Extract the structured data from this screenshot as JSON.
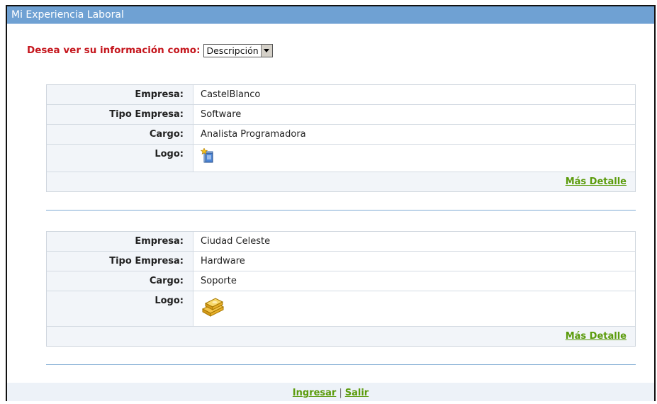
{
  "window": {
    "title": "Mi Experiencia Laboral"
  },
  "view_selector": {
    "label": "Desea ver su información como:",
    "selected": "Descripción"
  },
  "labels": {
    "empresa": "Empresa:",
    "tipo": "Tipo Empresa:",
    "cargo": "Cargo:",
    "logo": "Logo:"
  },
  "experiences": [
    {
      "empresa": "CastelBlanco",
      "tipo": "Software",
      "cargo": "Analista Programadora",
      "logo_icon": "document-new-icon",
      "more": "Más Detalle"
    },
    {
      "empresa": "Ciudad Celeste",
      "tipo": "Hardware",
      "cargo": "Soporte",
      "logo_icon": "gold-bars-icon",
      "more": "Más Detalle"
    }
  ],
  "footer": {
    "login": "Ingresar",
    "separator": "|",
    "logout": "Salir"
  }
}
